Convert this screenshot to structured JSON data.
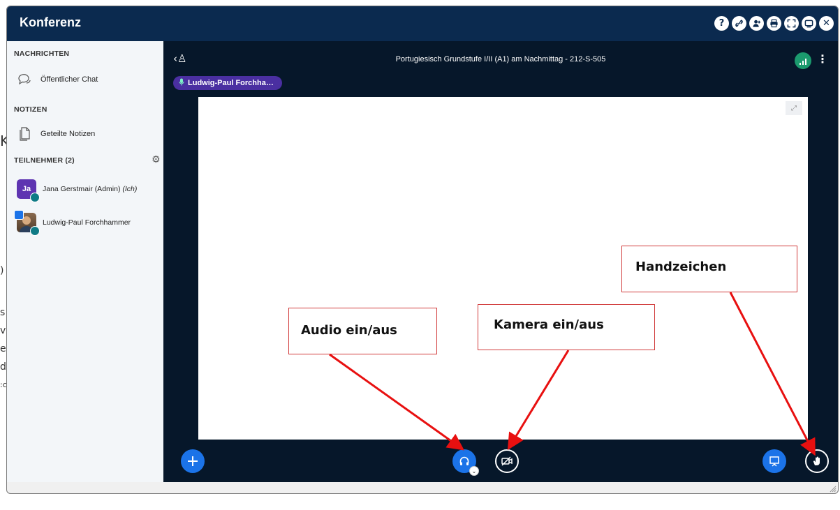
{
  "window": {
    "title": "Konferenz",
    "titlebar_icons": [
      "help-icon",
      "link-icon",
      "add-user-icon",
      "print-icon",
      "expand-icon",
      "minimize-icon",
      "close-icon"
    ],
    "titlebar_glyphs": [
      "?",
      "⚲",
      "+",
      "⎙",
      "⛶",
      "▭",
      "✕"
    ]
  },
  "background_fragments": [
    "K",
    ")",
    "s",
    "v",
    "e",
    "d",
    ":c"
  ],
  "sidebar": {
    "messages_header": "NACHRICHTEN",
    "public_chat": "Öffentlicher Chat",
    "notes_header": "NOTIZEN",
    "shared_notes": "Geteilte Notizen",
    "participants_header": "TEILNEHMER (2)",
    "users": [
      {
        "initials": "Ja",
        "name": "Jana Gerstmair (Admin)",
        "suffix": "(Ich)",
        "color": "#5e34b1"
      },
      {
        "initials": "",
        "name": "Ludwig-Paul Forchhammer",
        "suffix": "",
        "color": "#7a5a3a"
      }
    ]
  },
  "main": {
    "meeting_title": "Portugiesisch Grundstufe I/II (A1) am Nachmittag - 212-S-505",
    "current_speaker": "Ludwig-Paul Forchha…",
    "back_glyph": "‹♙",
    "kebab": "⋮",
    "fullscreen_glyph": "⤢"
  },
  "annotations": {
    "audio": "Audio ein/aus",
    "camera": "Kamera ein/aus",
    "hand": "Handzeichen"
  },
  "colors": {
    "titlebar": "#0b2a4f",
    "main_bg": "#06172a",
    "accent_blue": "#1b73e8",
    "speaker_pill": "#4a2fa1",
    "connection_ok": "#1b9a6e",
    "annotation": "#e81010"
  }
}
